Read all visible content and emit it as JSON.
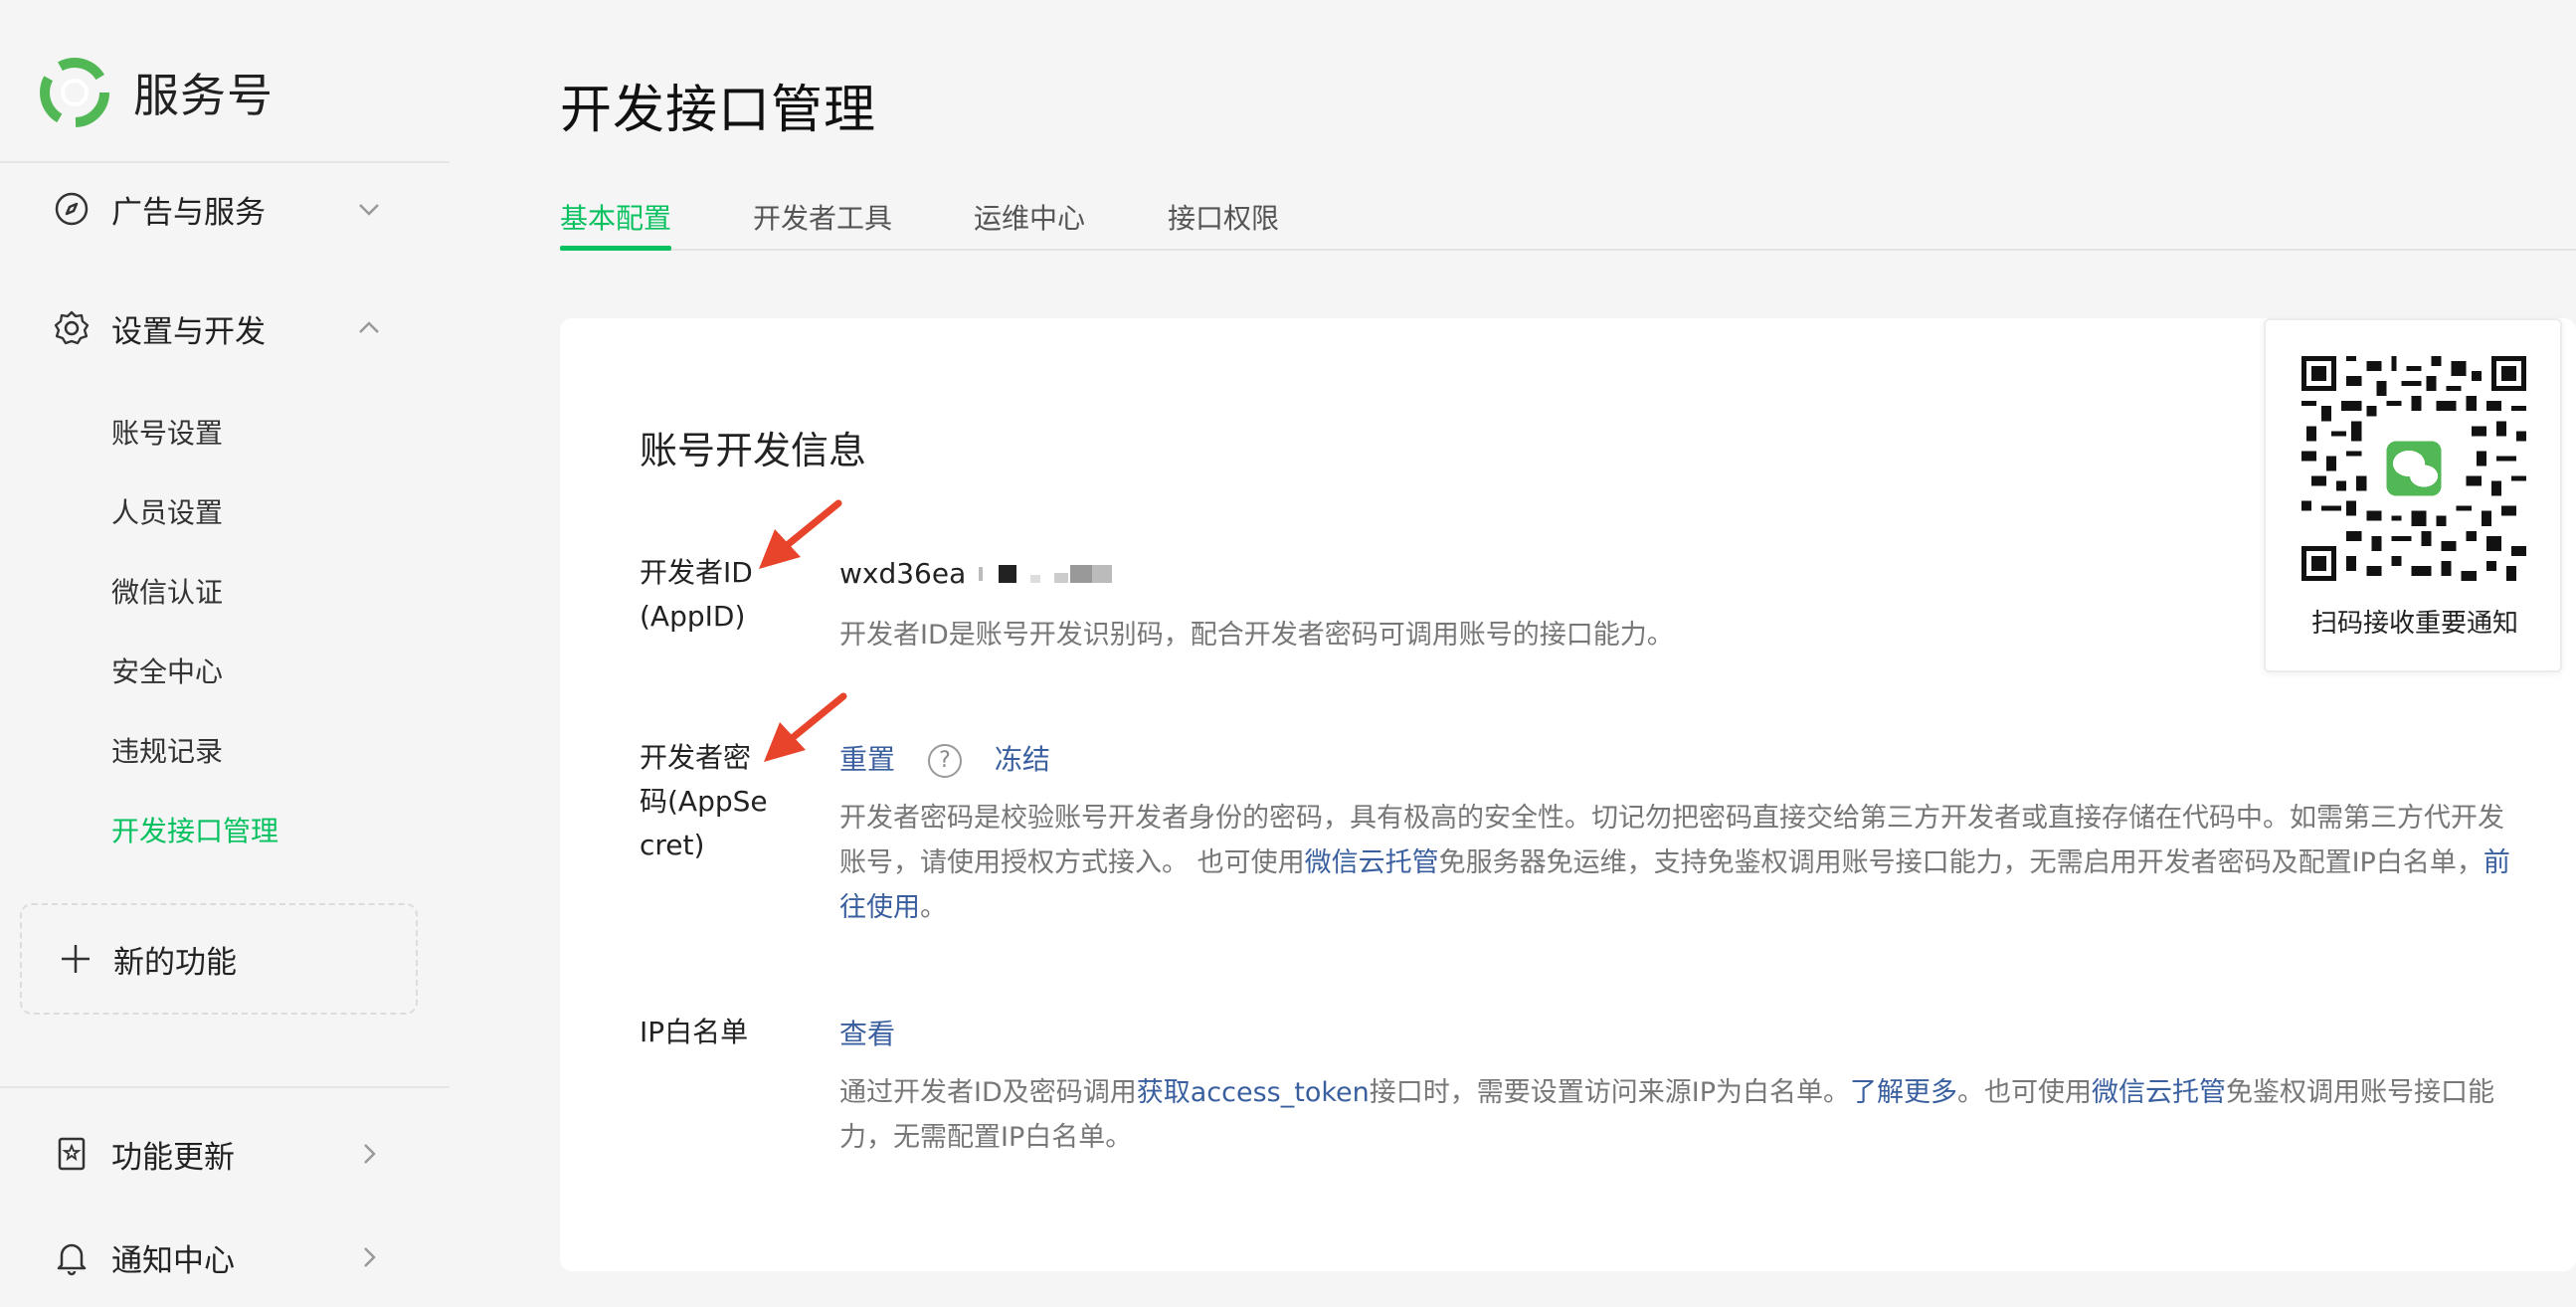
{
  "brand": {
    "name": "服务号"
  },
  "sidebar": {
    "groups": [
      {
        "label": "广告与服务",
        "icon": "compass-icon",
        "expanded": false
      },
      {
        "label": "设置与开发",
        "icon": "gear-icon",
        "expanded": true
      }
    ],
    "sub_items": [
      {
        "label": "账号设置",
        "active": false
      },
      {
        "label": "人员设置",
        "active": false
      },
      {
        "label": "微信认证",
        "active": false
      },
      {
        "label": "安全中心",
        "active": false
      },
      {
        "label": "违规记录",
        "active": false
      },
      {
        "label": "开发接口管理",
        "active": true
      }
    ],
    "new_function": {
      "label": "新的功能"
    },
    "footer": [
      {
        "label": "功能更新",
        "icon": "update-book-icon"
      },
      {
        "label": "通知中心",
        "icon": "bell-icon"
      }
    ]
  },
  "main": {
    "title": "开发接口管理",
    "tabs": [
      {
        "label": "基本配置",
        "active": true
      },
      {
        "label": "开发者工具",
        "active": false
      },
      {
        "label": "运维中心",
        "active": false
      },
      {
        "label": "接口权限",
        "active": false
      }
    ],
    "section_title": "账号开发信息",
    "app_id": {
      "label_line1": "开发者ID",
      "label_line2": "(AppID)",
      "value": "wxd36ea",
      "desc": "开发者ID是账号开发识别码，配合开发者密码可调用账号的接口能力。"
    },
    "app_secret": {
      "label_line1": "开发者密",
      "label_line2": "码(AppSe",
      "label_line3": "cret)",
      "reset": "重置",
      "help": "?",
      "freeze": "冻结",
      "desc_part1": "开发者密码是校验账号开发者身份的密码，具有极高的安全性。切记勿把密码直接交给第三方开发者或直接存储在代码中。如需第三方代开发账号，请使用授权方式接入。 也可使用",
      "desc_link1": "微信云托管",
      "desc_part2": "免服务器免运维，支持免鉴权调用账号接口能力，无需启用开发者密码及配置IP白名单，",
      "desc_link2": "前往使用",
      "desc_part3": "。"
    },
    "ip_whitelist": {
      "label": "IP白名单",
      "view": "查看",
      "desc_part1": "通过开发者ID及密码调用",
      "desc_link1": "获取access_token",
      "desc_part2": "接口时，需要设置访问来源IP为白名单。",
      "desc_link2": "了解更多",
      "desc_part3": "。也可使用",
      "desc_link3": "微信云托管",
      "desc_part4": "免鉴权调用账号接口能力，无需配置IP白名单。"
    }
  },
  "qr": {
    "caption": "扫码接收重要通知"
  },
  "colors": {
    "accent": "#07c160",
    "link": "#3a5f9f",
    "arrow": "#e8442c"
  }
}
